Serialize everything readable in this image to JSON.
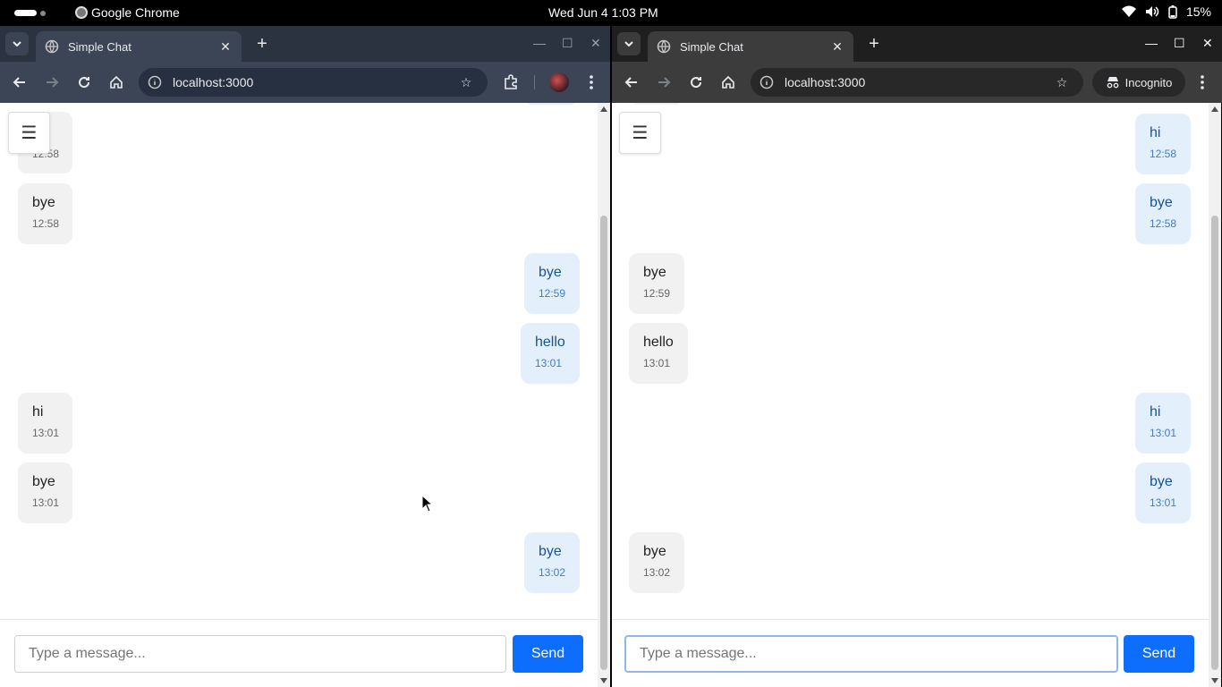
{
  "os": {
    "app_name": "Google Chrome",
    "clock": "Wed Jun 4   1:03 PM",
    "battery": "15%"
  },
  "left_window": {
    "tab_title": "Simple Chat",
    "url": "localhost:3000",
    "input_placeholder": "Type a message...",
    "send_label": "Send",
    "messages": [
      {
        "text": "",
        "time": "12:58",
        "side": "in"
      },
      {
        "text": "bye",
        "time": "12:58",
        "side": "in"
      },
      {
        "text": "bye",
        "time": "12:59",
        "side": "out"
      },
      {
        "text": "hello",
        "time": "13:01",
        "side": "out"
      },
      {
        "text": "hi",
        "time": "13:01",
        "side": "in"
      },
      {
        "text": "bye",
        "time": "13:01",
        "side": "in"
      },
      {
        "text": "bye",
        "time": "13:02",
        "side": "out"
      }
    ]
  },
  "right_window": {
    "tab_title": "Simple Chat",
    "url": "localhost:3000",
    "incognito_label": "Incognito",
    "input_placeholder": "Type a message...",
    "send_label": "Send",
    "messages": [
      {
        "text": "hi",
        "time": "12:58",
        "side": "out"
      },
      {
        "text": "bye",
        "time": "12:58",
        "side": "out"
      },
      {
        "text": "bye",
        "time": "12:59",
        "side": "in"
      },
      {
        "text": "hello",
        "time": "13:01",
        "side": "in"
      },
      {
        "text": "hi",
        "time": "13:01",
        "side": "out"
      },
      {
        "text": "bye",
        "time": "13:01",
        "side": "out"
      },
      {
        "text": "bye",
        "time": "13:02",
        "side": "in"
      }
    ]
  },
  "colors": {
    "incoming_bubble": "#f1f1f1",
    "outgoing_bubble": "#e3f0fc",
    "send_button": "#0d6efd"
  }
}
